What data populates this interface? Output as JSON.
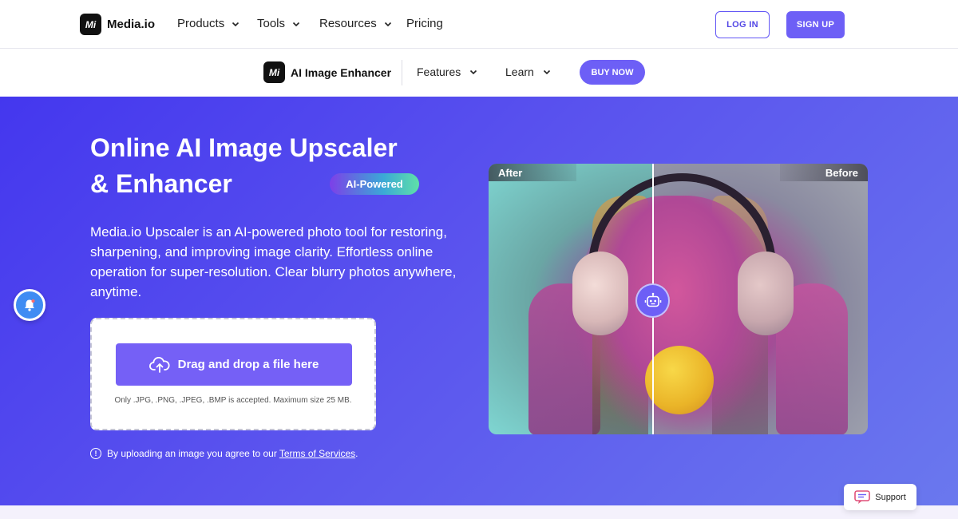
{
  "topnav": {
    "logo_text": "Media.io",
    "logo_mark": "Mi",
    "items": [
      {
        "label": "Products"
      },
      {
        "label": "Tools"
      },
      {
        "label": "Resources"
      },
      {
        "label": "Pricing"
      }
    ],
    "login_label": "LOG IN",
    "signup_label": "SIGN UP"
  },
  "subnav": {
    "title": "AI Image Enhancer",
    "items": [
      {
        "label": "Features"
      },
      {
        "label": "Learn"
      }
    ],
    "buy_label": "BUY NOW"
  },
  "hero": {
    "title_line1": "Online AI Image Upscaler",
    "title_line2": "& Enhancer",
    "badge": "AI-Powered",
    "description": "Media.io Upscaler is an AI-powered photo tool for restoring, sharpening, and improving image clarity. Effortless online operation for super-resolution. Clear blurry photos anywhere, anytime.",
    "upload_label": "Drag and drop a file here",
    "upload_note": "Only .JPG, .PNG, .JPEG, .BMP is accepted. Maximum size 25 MB.",
    "terms_prefix": "By uploading an image you agree to our",
    "terms_link": "Terms of Services",
    "terms_suffix": "."
  },
  "compare": {
    "after_label": "After",
    "before_label": "Before"
  },
  "support_label": "Support",
  "colors": {
    "brand": "#6d5ff6",
    "hero_start": "#4437ee",
    "hero_end": "#6a78ee"
  }
}
